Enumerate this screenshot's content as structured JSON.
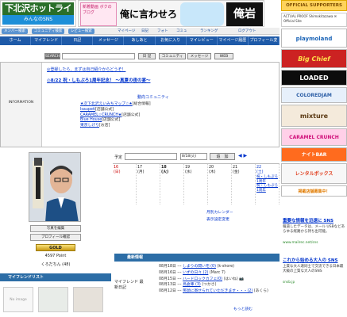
{
  "header": {
    "logo": "下北沢ホットライン",
    "logo_sub": "みんなのSNS",
    "banner": {
      "b1": "新着動画 ボクのブログ",
      "b2": "俺に言わせろ",
      "b4": "俺岩"
    },
    "official_supporters": "OFFICIAL SUPPORTERS",
    "official_note": "ACTUAL PROOF Shimokitazawa ✉ Official Site"
  },
  "subnav": {
    "buttons": [
      "メンバー検索",
      "コミュニティ検索",
      "レビュー検索"
    ],
    "icons": [
      "マイページ",
      "日記",
      "フォト",
      "コミュ",
      "ランキング",
      "ログアウト"
    ]
  },
  "nav": [
    "ホーム",
    "マイフレンド",
    "日記",
    "メッセージ",
    "あしあと",
    "お気に入り",
    "マイレビュー",
    "マイページ履歴",
    "プロフィール変更"
  ],
  "search": {
    "label": "SEARCH",
    "buttons": [
      "日 記",
      "コミュニティ",
      "メッセージ",
      "WEB"
    ]
  },
  "info": {
    "label": "INFORMATION",
    "msg1": "◎登録したら、まずは自己紹介からどうぞ！",
    "msg2": "◎8/22 祝・しもぷろ1周年記念！ 〜真夏の夜の宴〜",
    "rec_header": "動向コミュニティ",
    "communities": [
      {
        "name": "★次下北沢えいみちマップ☆★",
        "tag": "[総合情報]"
      },
      {
        "name": "Isaupeti",
        "tag": "[店舗公式]"
      },
      {
        "name": "CARAMEL☆CRUNCH★",
        "tag": "[店舗公式]"
      },
      {
        "name": "Blue House",
        "tag": "[店舗公式]"
      },
      {
        "name": "東京しげり",
        "tag": "[お店]"
      }
    ]
  },
  "profile": {
    "btn_photo": "写真を編集",
    "btn_profile": "プロフィール確認",
    "gold": "GOLD",
    "points": "4597 Point",
    "username": "くろだちん (48)",
    "photo_alt": "user photo"
  },
  "friends": {
    "header": "マイフレンドリスト",
    "noimg": "No image"
  },
  "schedule": {
    "label": "予定",
    "select_value": "8/18(火)",
    "add_btn": "追　加",
    "nav": "◀ ▶",
    "days": [
      {
        "date": "16",
        "wd": "(日)",
        "type": "sun",
        "events": []
      },
      {
        "date": "17",
        "wd": "(月)",
        "type": "",
        "events": []
      },
      {
        "date": "18",
        "wd": "(火)",
        "type": "today",
        "events": []
      },
      {
        "date": "19",
        "wd": "(水)",
        "type": "",
        "events": []
      },
      {
        "date": "20",
        "wd": "(木)",
        "type": "",
        "events": []
      },
      {
        "date": "21",
        "wd": "(金)",
        "type": "",
        "events": []
      },
      {
        "date": "22",
        "wd": "(土)",
        "type": "sat",
        "events": [
          "祝・しもぷろ1周年",
          "祝・しもぷろ1周年"
        ]
      }
    ],
    "link_month": "月別カレンダー",
    "link_settings": "表示設定変更"
  },
  "news": {
    "header": "最新情報",
    "label": "マイフレンド 最新日記",
    "items": [
      {
        "date": "08月18日 ---",
        "title": "しまりの間い宅 (0)",
        "by": "(k-shore)"
      },
      {
        "date": "08月16日 ---",
        "title": "いずの日々 (2)",
        "by": "(Marc 7)"
      },
      {
        "date": "08月15日 ---",
        "title": "ハードロックカフェ(0)",
        "by": "(はいね) 📷"
      },
      {
        "date": "08月13日 ---",
        "title": "鳥倉庫 (3)",
        "by": "(つかさ)"
      },
      {
        "date": "08月12日 ---",
        "title": "笑顔に寄せられていただきます・・・(2)",
        "by": "(あくら)"
      }
    ],
    "more": "もっと読む"
  },
  "ads": [
    "playmoland",
    "Big Chief",
    "LOADED",
    "COLOREDJAM",
    "mixture",
    "CARAMEL CRUNCH",
    "ナイトBAR",
    "レンタルボックス",
    "掲載店舗募集中！"
  ],
  "right_footer": {
    "h1": "重要な情報を迅速に SNS",
    "t1": "報道したデータは、メール USBなどあらゆる経路から持ち出可能。",
    "l1": "www.mailrec.net/sns",
    "h2": "これから始める大人の SNS",
    "t2": "上質な大人達同士で交流できる日本最大級の上質な大人のSNS",
    "l2": "snsb.jp"
  }
}
